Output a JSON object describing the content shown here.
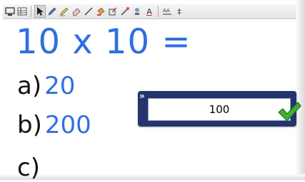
{
  "toolbar": {
    "tools": [
      {
        "name": "pointer-icon",
        "active": true
      },
      {
        "name": "pen-icon"
      },
      {
        "name": "highlighter-icon"
      },
      {
        "name": "eraser-icon"
      },
      {
        "name": "line-icon"
      },
      {
        "name": "fill-icon"
      },
      {
        "name": "shape-icon"
      },
      {
        "name": "magic-pen-icon"
      },
      {
        "name": "stamp-icon"
      },
      {
        "name": "text-icon"
      }
    ],
    "text_tool_label": "A",
    "font_size_label": "‡"
  },
  "question": {
    "equation": "10 x 10 ="
  },
  "options": [
    {
      "letter": "a)",
      "value": "20"
    },
    {
      "letter": "b)",
      "value": "200"
    },
    {
      "letter": "c)",
      "value": ""
    }
  ],
  "answer": {
    "value": "100",
    "expand_label": "»",
    "status": "correct"
  },
  "colors": {
    "accent": "#2f6fe0",
    "answer_frame": "#26336e",
    "check": "#3fae34"
  }
}
